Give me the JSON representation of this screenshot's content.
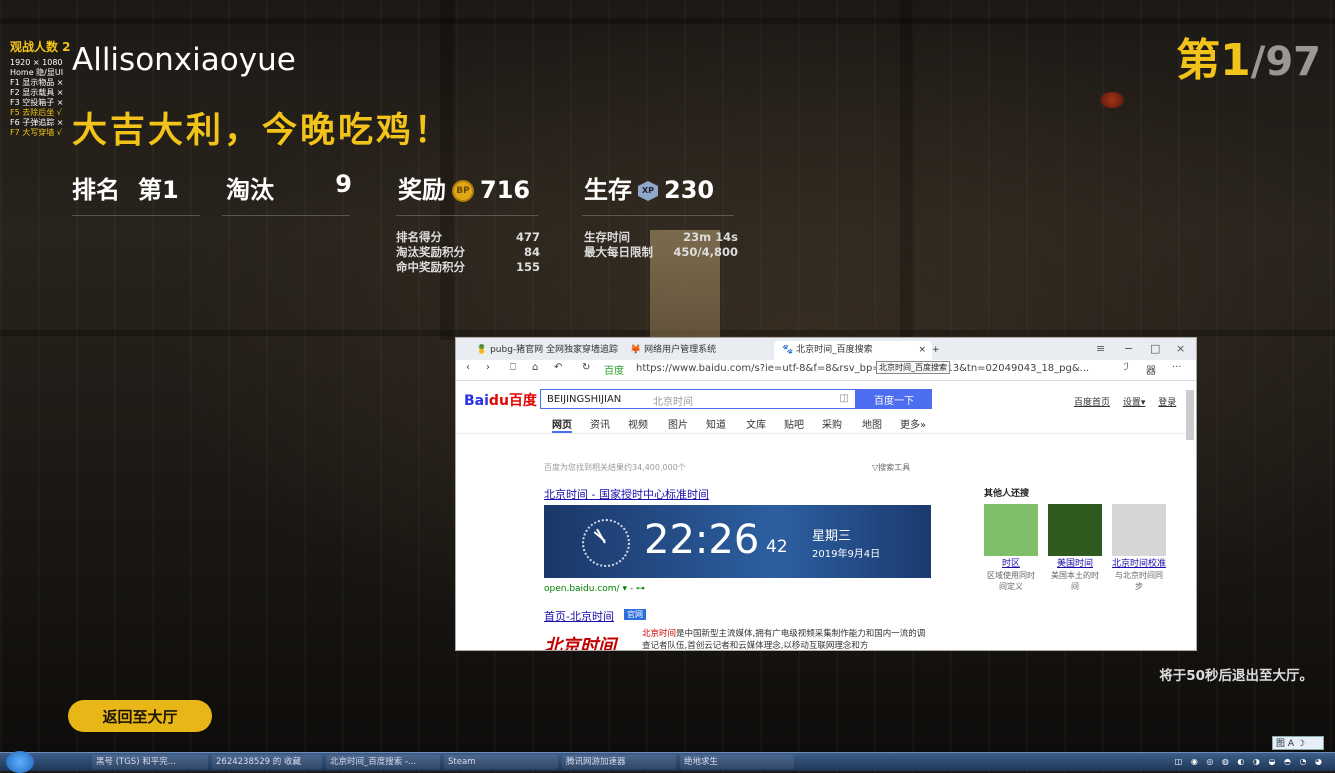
{
  "overlay": {
    "title": "观战人数 2",
    "menu": [
      {
        "text": "1920 × 1080",
        "on": false
      },
      {
        "text": "Home 隐/显UI",
        "on": false
      },
      {
        "text": "F1 显示物品 ×",
        "on": false
      },
      {
        "text": "F2 显示载具 ×",
        "on": false
      },
      {
        "text": "F3 空投箱子 ×",
        "on": false
      },
      {
        "text": "F5 去除后坐 √",
        "on": true
      },
      {
        "text": "F6 子弹追踪 ×",
        "on": false
      },
      {
        "text": "F7 大写穿墙 √",
        "on": true
      }
    ]
  },
  "result": {
    "player_name": "Allisonxiaoyue",
    "headline": "大吉大利，今晚吃鸡！",
    "rank_label": "排名",
    "rank_value": "第1",
    "kills_label": "淘汰",
    "kills_value": "9",
    "reward_label": "奖励",
    "reward_value": "716",
    "reward_icon": "bp-coin-icon",
    "survival_label": "生存",
    "survival_value": "230",
    "survival_icon": "xp-icon",
    "rank_badge_current": "第1",
    "rank_badge_total": "/97",
    "reward_breakdown": [
      {
        "label": "排名得分",
        "value": "477"
      },
      {
        "label": "淘汰奖励积分",
        "value": "84"
      },
      {
        "label": "命中奖励积分",
        "value": "155"
      }
    ],
    "survival_breakdown": [
      {
        "label": "生存时间",
        "value": "23m 14s"
      },
      {
        "label": "最大每日限制",
        "value": "450/4,800"
      }
    ],
    "exit_message": "将于50秒后退出至大厅。",
    "back_button": "返回至大厅"
  },
  "browser": {
    "tabs": [
      {
        "label": "pubg-猪官网 全网独家穿墙追踪",
        "active": false
      },
      {
        "label": "网络用户管理系统",
        "active": false
      },
      {
        "label": "北京时间_百度搜索",
        "active": true
      }
    ],
    "new_tab": "+",
    "tab_close": "×",
    "window_controls": [
      "≡",
      "−",
      "□",
      "×"
    ],
    "nav": {
      "back": "‹",
      "forward": "›",
      "bookmark": "⎕",
      "home": "⌂",
      "undo": "↶",
      "reload": "↻",
      "site_name": "百度"
    },
    "url": "https://www.baidu.com/s?ie=utf-8&f=8&rsv_bp=",
    "url_suffix": "=13&tn=02049043_18_pg&...",
    "tooltip": "北京时间_百度搜索",
    "toolbar_right": [
      "ℐ",
      "器",
      "···"
    ],
    "baidu": {
      "logo": "Bai",
      "logo_paw": "du",
      "logo_cn": "百度",
      "query": "BEIJINGSHIJIAN",
      "query_hint": "北京时间",
      "search_button": "百度一下",
      "top_links": [
        "百度首页",
        "设置▾",
        "登录"
      ],
      "tabs": [
        "网页",
        "资讯",
        "视频",
        "图片",
        "知道",
        "文库",
        "贴吧",
        "采购",
        "地图",
        "更多»"
      ],
      "result_count": "百度为您找到相关结果约34,400,000个",
      "search_tools": "▽搜索工具",
      "result1_title": "北京时间 - 国家授时中心标准时间",
      "clock_time": "22:26",
      "clock_seconds": "42",
      "clock_weekday": "星期三",
      "clock_date": "2019年9月4日",
      "result1_site": "open.baidu.com/  ▾ - ⊶",
      "result2_title": "首页-北京时间",
      "result2_tag": "官网",
      "result2_logo": "北京时间",
      "result2_text_em": "北京时间",
      "result2_text": "是中国新型主流媒体,拥有广电级视频采集制作能力和国内一流的调查记者队伍,首创云记者和云媒体理念,以移动互联网理念和方",
      "sidebar_heading": "其他人还搜",
      "sidebar_items": [
        {
          "title": "时区",
          "desc": "区域使用同时间定义",
          "color": "#7fbf6a"
        },
        {
          "title": "美国时间",
          "desc": "美国本土的时间",
          "color": "#2f5b1f"
        },
        {
          "title": "北京时间校准",
          "desc": "与北京时间同步",
          "color": "#d6d6d6"
        }
      ]
    }
  },
  "taskbar": {
    "items": [
      "黑号 (TGS) 和平完...",
      "2624238529 的 收藏",
      "北京时间_百度搜索 -...",
      "Steam",
      "腾讯网游加速器",
      "绝地求生"
    ],
    "tray": "◫ ◉ ◎ ◍ ◐ ◑ ◒ ◓ ◔ ◕",
    "ime": "图 A ☽"
  }
}
